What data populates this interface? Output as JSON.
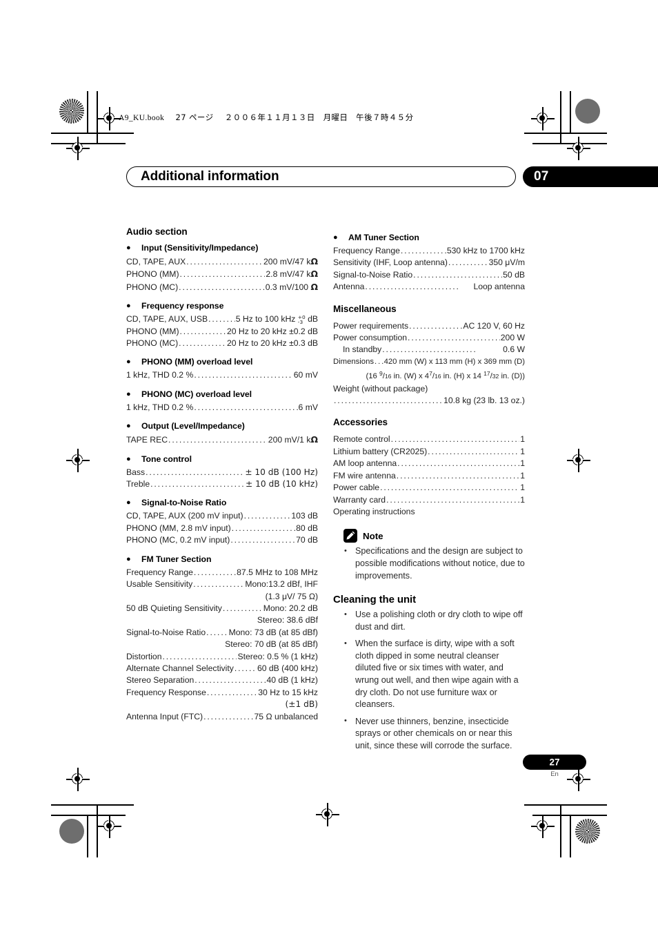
{
  "print_header": {
    "filename": "A9_KU.book",
    "page_marker": "27 ページ",
    "date": "２００６年１１月１３日　月曜日　午後７時４５分"
  },
  "chapter": {
    "title": "Additional information",
    "number": "07"
  },
  "footer": {
    "page_number": "27",
    "language": "En"
  },
  "left_column": {
    "section_title": "Audio section",
    "groups": [
      {
        "heading": "Input (Sensitivity/Impedance)",
        "rows": [
          {
            "label": "CD, TAPE, AUX",
            "value": "200 mV/47 k",
            "unit": "ohm"
          },
          {
            "label": "PHONO (MM)",
            "value": "2.8 mV/47 k",
            "unit": "ohm"
          },
          {
            "label": "PHONO (MC)",
            "value": "0.3 mV/100 ",
            "unit": "ohm"
          }
        ]
      },
      {
        "heading": "Frequency response",
        "rows": [
          {
            "label": "CD, TAPE, AUX, USB",
            "value": "5 Hz to 100 kHz",
            "tolerance_top": "+0",
            "tolerance_bottom": "-3",
            "suffix": " dB"
          },
          {
            "label": "PHONO (MM)",
            "value": "20 Hz to 20 kHz ±0.2 dB"
          },
          {
            "label": "PHONO (MC)",
            "value": "20 Hz to 20 kHz ±0.3 dB"
          }
        ]
      },
      {
        "heading": "PHONO (MM) overload level",
        "rows": [
          {
            "label": "1 kHz, THD 0.2 %",
            "value": "60 mV"
          }
        ]
      },
      {
        "heading": "PHONO (MC) overload level",
        "rows": [
          {
            "label": "1 kHz, THD 0.2 %",
            "value": "6 mV"
          }
        ]
      },
      {
        "heading": "Output (Level/Impedance)",
        "rows": [
          {
            "label": "TAPE REC",
            "value": "200 mV/1 k",
            "unit": "ohm"
          }
        ]
      },
      {
        "heading": "Tone control",
        "rows": [
          {
            "label": "Bass",
            "value": "± 10 dB (100 Hz)"
          },
          {
            "label": "Treble",
            "value": "± 10 dB (10 kHz)"
          }
        ]
      },
      {
        "heading": "Signal-to-Noise Ratio",
        "rows": [
          {
            "label": "CD, TAPE, AUX (200 mV input)",
            "value": "103 dB"
          },
          {
            "label": "PHONO (MM, 2.8 mV input)",
            "value": "80 dB"
          },
          {
            "label": "PHONO (MC, 0.2 mV input)",
            "value": "70 dB"
          }
        ]
      },
      {
        "heading": "FM Tuner Section",
        "rows": [
          {
            "label": "Frequency Range",
            "value": "87.5 MHz to 108 MHz"
          },
          {
            "label": "Usable Sensitivity",
            "value": "Mono:13.2 dBf, IHF"
          },
          {
            "continuation": "(1.3 μV/ 75 Ω)"
          },
          {
            "label": "50 dB Quieting Sensitivity",
            "value": "Mono: 20.2 dB"
          },
          {
            "continuation": "Stereo: 38.6 dBf"
          },
          {
            "label": "Signal-to-Noise Ratio",
            "value": "Mono: 73 dB (at 85 dBf)"
          },
          {
            "continuation": "Stereo: 70 dB (at 85 dBf)"
          },
          {
            "label": "Distortion",
            "value": "Stereo: 0.5 % (1 kHz)"
          },
          {
            "label": "Alternate Channel Selectivity",
            "value": "60 dB (400 kHz)"
          },
          {
            "label": "Stereo Separation",
            "value": "40 dB (1 kHz)"
          },
          {
            "label": "Frequency Response",
            "value": "30 Hz to 15 kHz"
          },
          {
            "continuation": "(±1 dB)"
          },
          {
            "label": "Antenna Input (FTC)",
            "value": "75 Ω unbalanced"
          }
        ]
      }
    ]
  },
  "right_column": {
    "am_tuner": {
      "heading": "AM Tuner Section",
      "rows": [
        {
          "label": "Frequency Range",
          "value": "530 kHz to 1700 kHz"
        },
        {
          "label": "Sensitivity (IHF, Loop antenna)",
          "value": "350 μV/m"
        },
        {
          "label": "Signal-to-Noise Ratio",
          "value": "50 dB"
        },
        {
          "label": "Antenna",
          "value": "Loop antenna"
        }
      ]
    },
    "miscellaneous": {
      "heading": "Miscellaneous",
      "rows": [
        {
          "label": "Power requirements",
          "value": "AC 120 V, 60 Hz"
        },
        {
          "label": "Power consumption",
          "value": "200 W"
        },
        {
          "label": "In standby",
          "value": "0.6 W",
          "indent": true
        },
        {
          "label": "Dimensions",
          "value": "420 mm (W) x 113 mm (H) x 369 mm (D)"
        },
        {
          "continuation_fraction": "(16 9/16 in. (W) x 4 7/16 in. (H) x 14 17/32 in. (D))"
        },
        {
          "label": "Weight (without package)",
          "nodots": true
        },
        {
          "label": "",
          "value": "10.8 kg (23 lb. 13 oz.)"
        }
      ]
    },
    "accessories": {
      "heading": "Accessories",
      "rows": [
        {
          "label": "Remote control",
          "value": "1"
        },
        {
          "label": "Lithium battery (CR2025)",
          "value": "1"
        },
        {
          "label": "AM loop antenna",
          "value": "1"
        },
        {
          "label": "FM wire antenna",
          "value": "1"
        },
        {
          "label": "Power cable",
          "value": "1"
        },
        {
          "label": "Warranty card",
          "value": "1"
        },
        {
          "label": "Operating instructions",
          "nodots": true
        }
      ]
    },
    "note": {
      "label": "Note",
      "icon": "pencil-icon",
      "items": [
        "Specifications and the design are subject to possible modifications without notice, due to improvements."
      ]
    },
    "cleaning": {
      "heading": "Cleaning the unit",
      "items": [
        "Use a polishing cloth or dry cloth to wipe off dust and dirt.",
        "When the surface is dirty, wipe with a soft cloth dipped in some neutral cleanser diluted five or six times with water, and wrung out well, and then wipe again with a dry cloth. Do not use furniture wax or cleansers.",
        "Never use thinners, benzine, insecticide sprays or other chemicals on or near this unit, since these will corrode the surface."
      ]
    }
  },
  "colors": {
    "accent_black": "#000000",
    "body_text": "#222222"
  }
}
